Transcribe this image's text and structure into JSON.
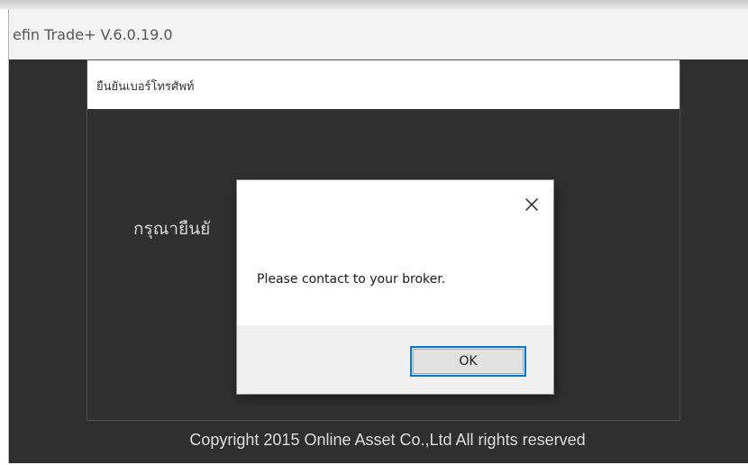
{
  "main_window": {
    "title": "efin Trade+ V.6.0.19.0",
    "footer": "Copyright 2015 Online Asset Co.,Ltd  All rights reserved"
  },
  "phone_dialog": {
    "title": "ยืนยันเบอร์โทรศัพท์",
    "prompt_visible": "กรุณายืนยั"
  },
  "message_box": {
    "message": "Please contact to your broker.",
    "ok_label": "OK",
    "close_icon": "close-icon"
  },
  "colors": {
    "dark_background": "#2f2f2f",
    "focus_border": "#0078d7",
    "footer_text": "#dedede"
  }
}
